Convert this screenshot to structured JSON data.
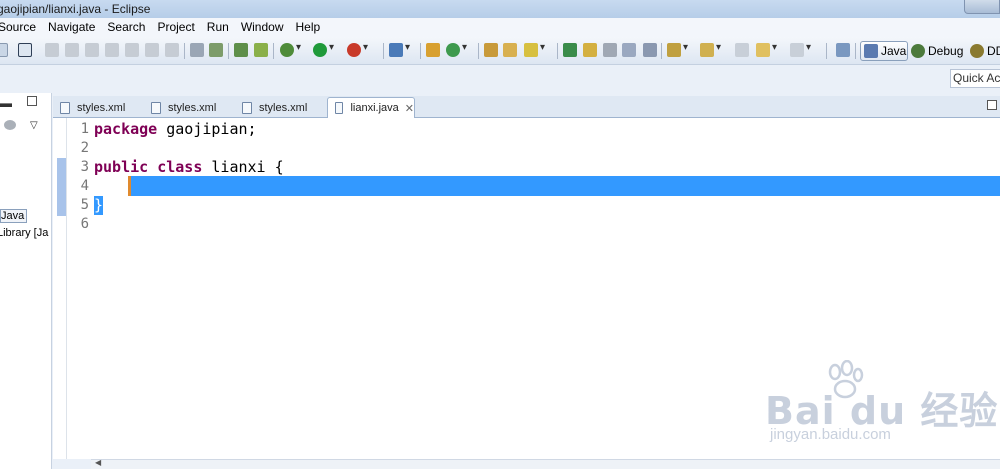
{
  "window": {
    "title": "gaojipian/lianxi.java - Eclipse"
  },
  "menu": [
    "Source",
    "Navigate",
    "Search",
    "Project",
    "Run",
    "Window",
    "Help"
  ],
  "perspectives": [
    {
      "label": "Java",
      "icon": "java-perspective-icon",
      "active": true
    },
    {
      "label": "Debug",
      "icon": "debug-perspective-icon",
      "active": false
    },
    {
      "label": "DD",
      "icon": "ddms-perspective-icon",
      "active": false
    }
  ],
  "quick_access": {
    "placeholder": "Quick Acc"
  },
  "left_panel": {
    "items": [
      "Java",
      "Library [Ja"
    ]
  },
  "tabs": [
    {
      "label": "styles.xml",
      "active": false
    },
    {
      "label": "styles.xml",
      "active": false
    },
    {
      "label": "styles.xml",
      "active": false
    },
    {
      "label": "lianxi.java",
      "active": true
    }
  ],
  "editor": {
    "line_numbers": [
      "1",
      "2",
      "3",
      "4",
      "5",
      "6"
    ],
    "lines": {
      "l1_kw": "package",
      "l1_rest": " gaojipian;",
      "l3_kw1": "public",
      "l3_kw2": "class",
      "l3_rest": " lianxi {",
      "l5": "}"
    }
  },
  "watermark": {
    "logo": "Bai du 经验",
    "url": "jingyan.baidu.com"
  }
}
